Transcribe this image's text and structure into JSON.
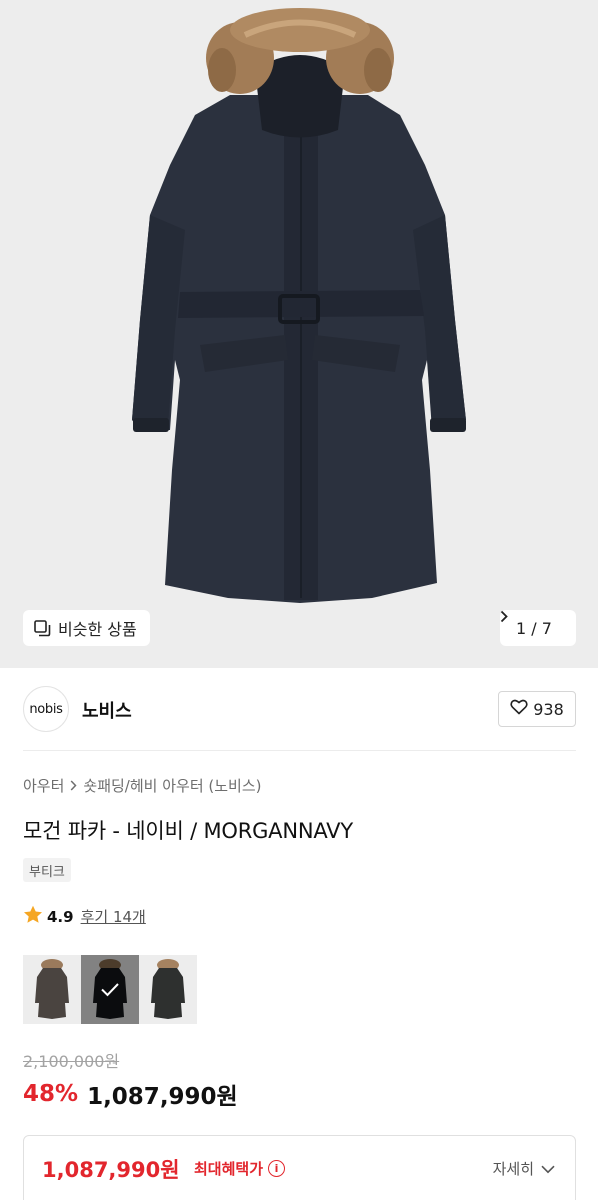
{
  "gallery": {
    "similar_label": "비슷한 상품",
    "counter": "1 / 7",
    "icons": {
      "similar": "similar-items-icon",
      "next": "chevron-right-icon"
    }
  },
  "brand": {
    "logo_text": "nobis",
    "name": "노비스",
    "like_count": "938",
    "icons": {
      "like": "heart-icon"
    }
  },
  "breadcrumb": {
    "level1": "아우터",
    "level2": "숏패딩/헤비 아우터 (노비스)"
  },
  "product": {
    "title": "모건 파카 - 네이비 / MORGANNAVY",
    "tag": "부티크",
    "rating": "4.9",
    "reviews": "후기 14개"
  },
  "colors": {
    "options": [
      "dark-grey",
      "black",
      "charcoal"
    ],
    "selected_index": 1
  },
  "price": {
    "original": "2,100,000원",
    "discount": "48%",
    "sale": "1,087,990원"
  },
  "benefit": {
    "price": "1,087,990원",
    "label": "최대혜택가",
    "detail_label": "자세히"
  },
  "theme": {
    "accent_red": "#e2262d",
    "star_yellow": "#f5a623",
    "coat_navy": "#2b313e",
    "fur": "#a27c56"
  }
}
